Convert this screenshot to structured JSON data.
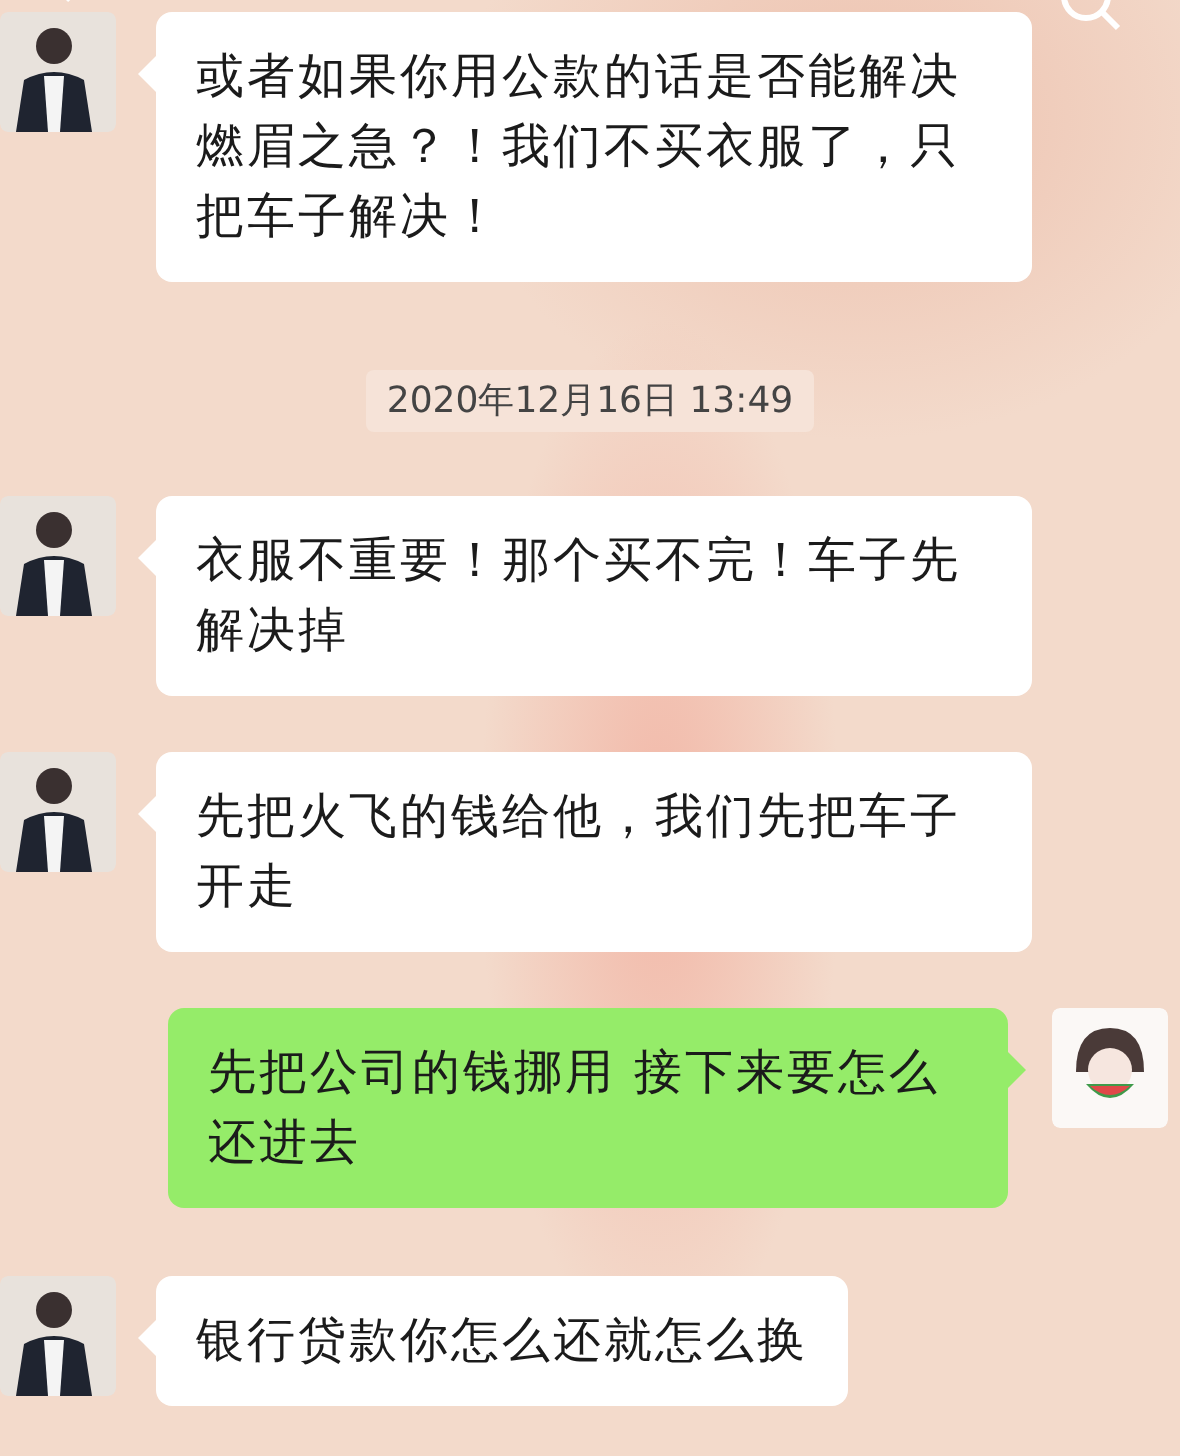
{
  "messages": [
    {
      "kind": "received",
      "text": "或者如果你用公款的话是否能解决燃眉之急？！我们不买衣服了，只把车子解决！"
    },
    {
      "kind": "time",
      "text": "2020年12月16日 13:49"
    },
    {
      "kind": "received",
      "text": "衣服不重要！那个买不完！车子先解决掉"
    },
    {
      "kind": "received",
      "text": "先把火飞的钱给他，我们先把车子开走"
    },
    {
      "kind": "sent",
      "text": "先把公司的钱挪用 接下来要怎么还进去"
    },
    {
      "kind": "received",
      "text": "银行贷款你怎么还就怎么换"
    }
  ]
}
